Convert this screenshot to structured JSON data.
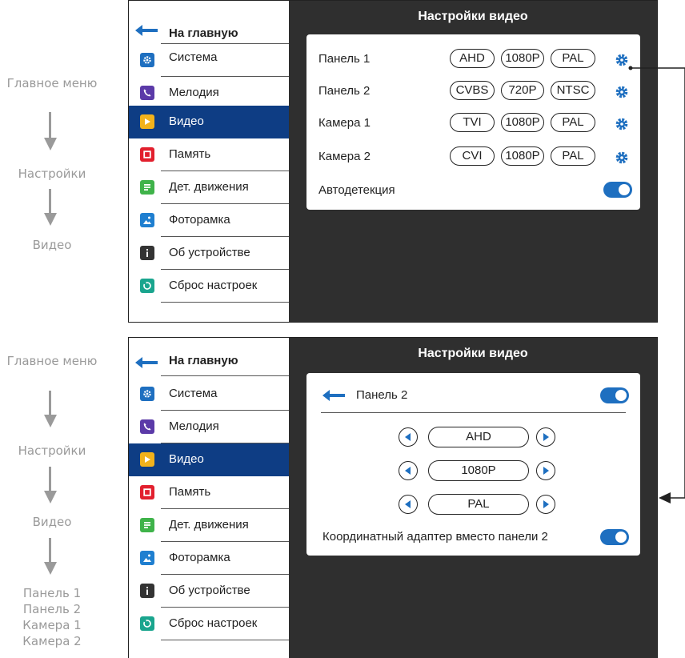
{
  "side_captions_top": [
    "Главное меню",
    "Настройки",
    "Видео"
  ],
  "side_captions_bottom": [
    "Главное меню",
    "Настройки",
    "Видео"
  ],
  "side_list_bottom": [
    "Панель 1",
    "Панель 2",
    "Камера 1",
    "Камера 2"
  ],
  "menu": {
    "home_label": "На главную",
    "items": [
      {
        "label": "Система",
        "icon": "gear-icon",
        "color": "#1e6fc0"
      },
      {
        "label": "Мелодия",
        "icon": "phone-icon",
        "color": "#5b3aa8"
      },
      {
        "label": "Видео",
        "icon": "play-icon",
        "color": "#f2b21b",
        "active": true
      },
      {
        "label": "Память",
        "icon": "memory-icon",
        "color": "#e2202e"
      },
      {
        "label": "Дет. движения",
        "icon": "motion-icon",
        "color": "#3fb34a"
      },
      {
        "label": "Фоторамка",
        "icon": "photo-icon",
        "color": "#1f7fd0"
      },
      {
        "label": "Об устройстве",
        "icon": "info-icon",
        "color": "#333333"
      },
      {
        "label": "Сброс настроек",
        "icon": "reset-icon",
        "color": "#1aa58e"
      }
    ]
  },
  "screen1": {
    "title": "Настройки видео",
    "rows": [
      {
        "name": "Панель 1",
        "format": "AHD",
        "resolution": "1080P",
        "standard": "PAL"
      },
      {
        "name": "Панель 2",
        "format": "CVBS",
        "resolution": "720P",
        "standard": "NTSC"
      },
      {
        "name": "Камера 1",
        "format": "TVI",
        "resolution": "1080P",
        "standard": "PAL"
      },
      {
        "name": "Камера 2",
        "format": "CVI",
        "resolution": "1080P",
        "standard": "PAL"
      }
    ],
    "autodetect_label": "Автодетекция",
    "autodetect_on": true
  },
  "screen2": {
    "title": "Настройки видео",
    "header_label": "Панель 2",
    "header_toggle_on": true,
    "selectors": [
      "AHD",
      "1080P",
      "PAL"
    ],
    "adapter_label": "Координатный адаптер вместо панели 2",
    "adapter_on": true
  },
  "colors": {
    "accent": "#1e6fc0",
    "menu_active": "#0e3d84",
    "panel_bg": "#2f2f2f",
    "caption_gray": "#9a9a9a"
  }
}
